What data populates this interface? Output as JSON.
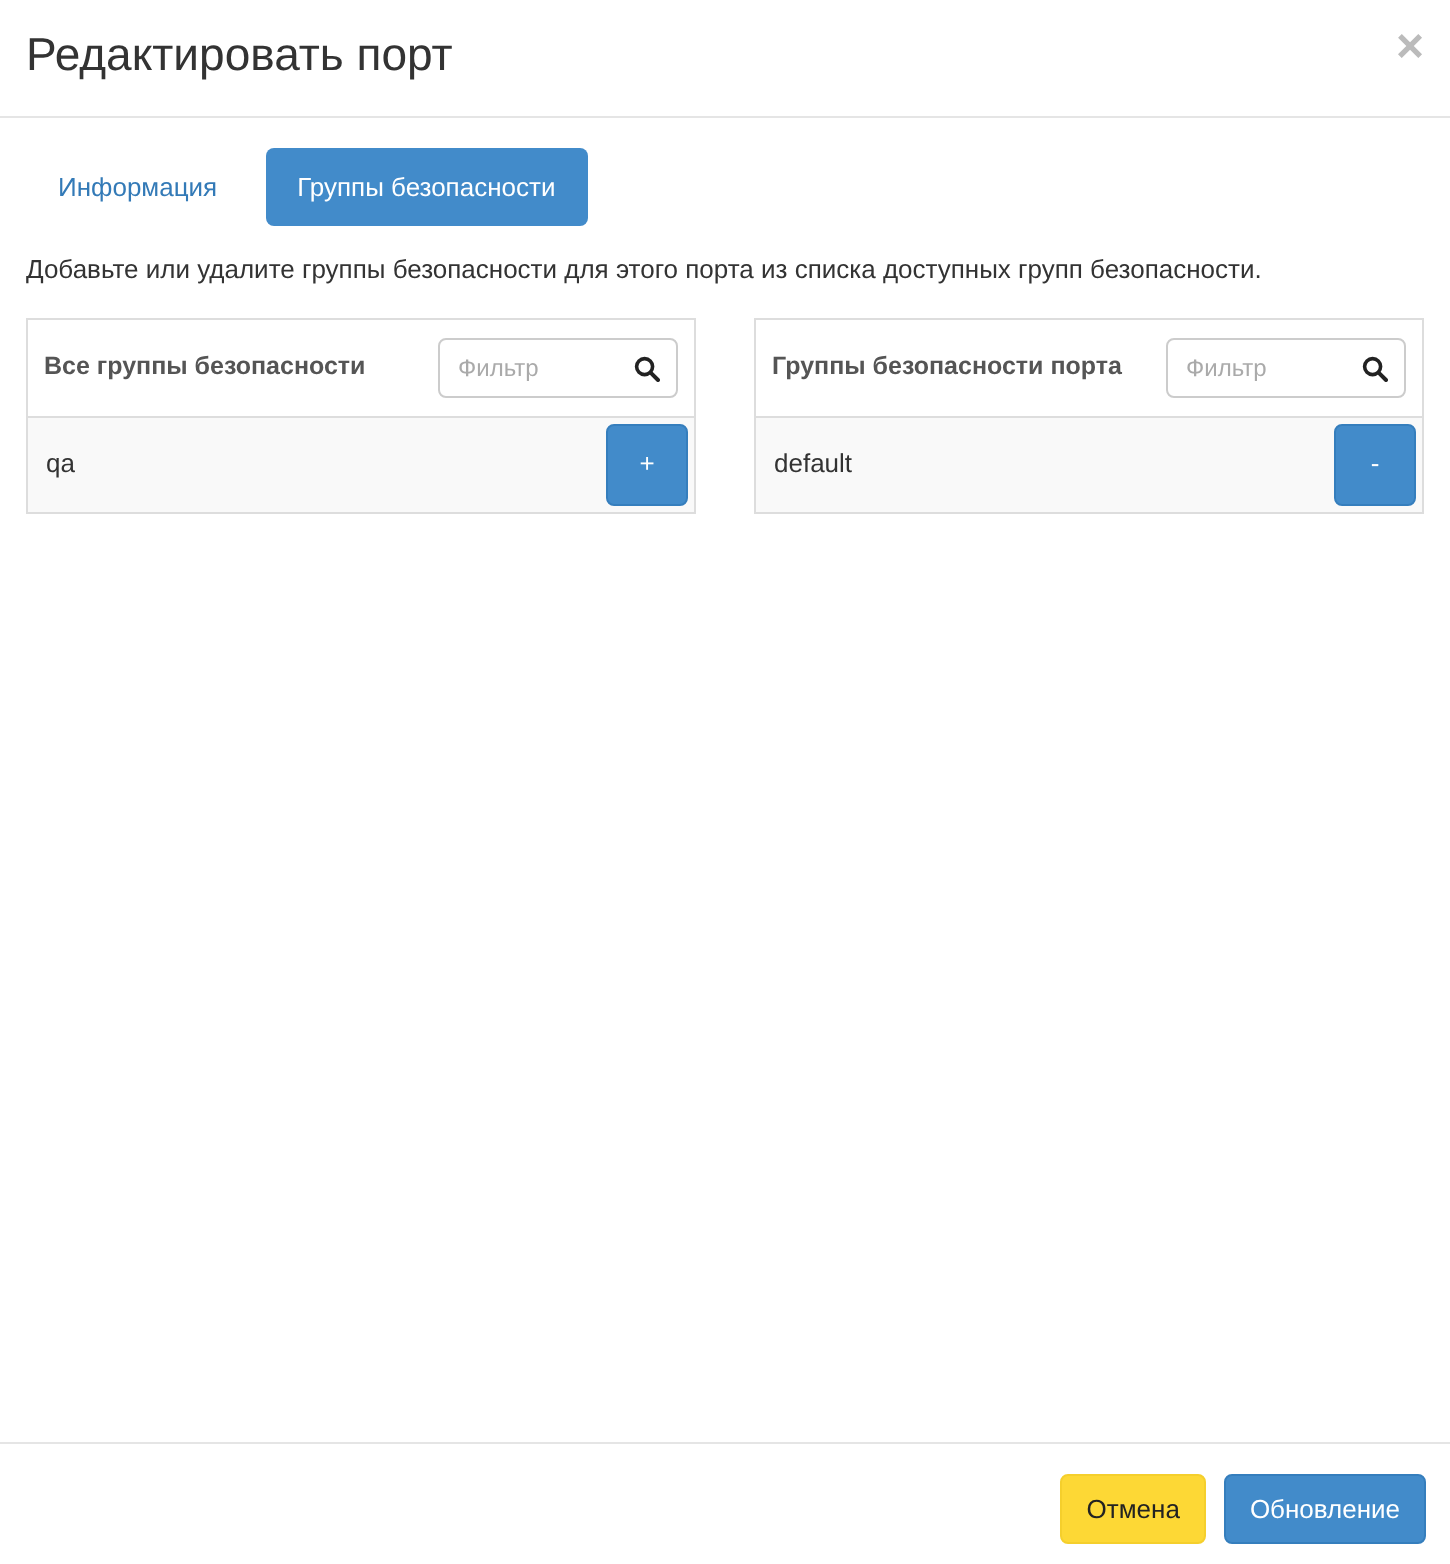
{
  "modal": {
    "title": "Редактировать порт",
    "close": "×"
  },
  "tabs": [
    {
      "label": "Информация",
      "selected": false
    },
    {
      "label": "Группы безопасности",
      "selected": true
    }
  ],
  "description": "Добавьте или удалите группы безопасности для этого порта из списка доступных групп безопасности.",
  "lists": [
    {
      "heading": "Все группы безопасности",
      "filter": {
        "placeholder": "Фильтр"
      },
      "items": [
        {
          "name": "qa",
          "action": "+"
        }
      ]
    },
    {
      "heading": "Группы безопасности порта",
      "filter": {
        "placeholder": "Фильтр"
      },
      "items": [
        {
          "name": "default",
          "action": "-"
        }
      ]
    }
  ],
  "buttons": [
    {
      "label": "Отмена",
      "kind": "cancel"
    },
    {
      "label": "Обновление",
      "kind": "primary"
    }
  ]
}
